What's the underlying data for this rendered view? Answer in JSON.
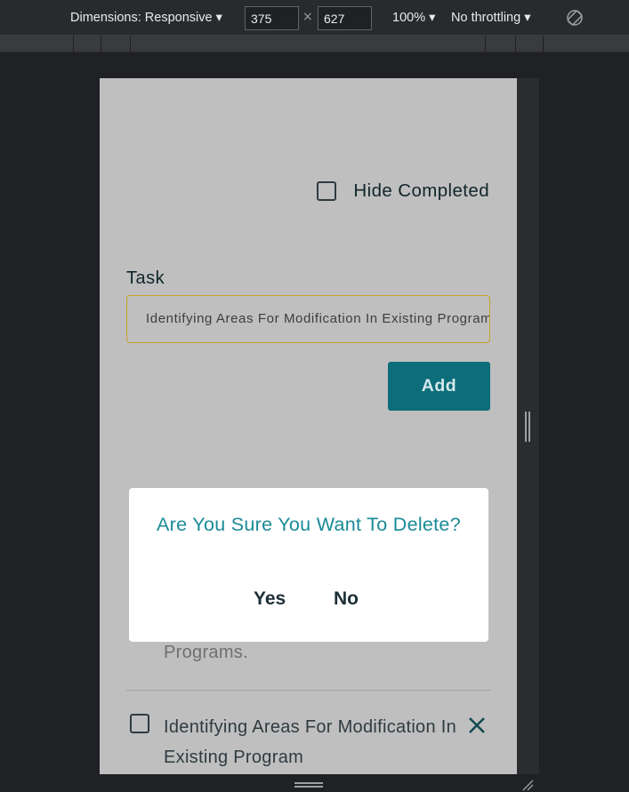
{
  "devtools": {
    "dimensions_label": "Dimensions: Responsive ▾",
    "width": "375",
    "height": "627",
    "times": "×",
    "zoom": "100% ▾",
    "throttling": "No throttling ▾",
    "rotate_icon": "rotate-icon"
  },
  "app": {
    "hide_completed_label": "Hide Completed",
    "task_label": "Task",
    "task_input_value": "Identifying Areas For Modification In Existing Program",
    "add_label": "Add",
    "faded_item_text": "Programs.",
    "item2_text": "Identifying Areas For Modification In Existing Program"
  },
  "modal": {
    "title": "Are You Sure You Want To Delete?",
    "yes_label": "Yes",
    "no_label": "No"
  },
  "colors": {
    "accent_teal": "#0d6e7a",
    "modal_title": "#1a8a97",
    "input_border": "#c9a227",
    "viewport_bg": "#bfbfbf"
  }
}
